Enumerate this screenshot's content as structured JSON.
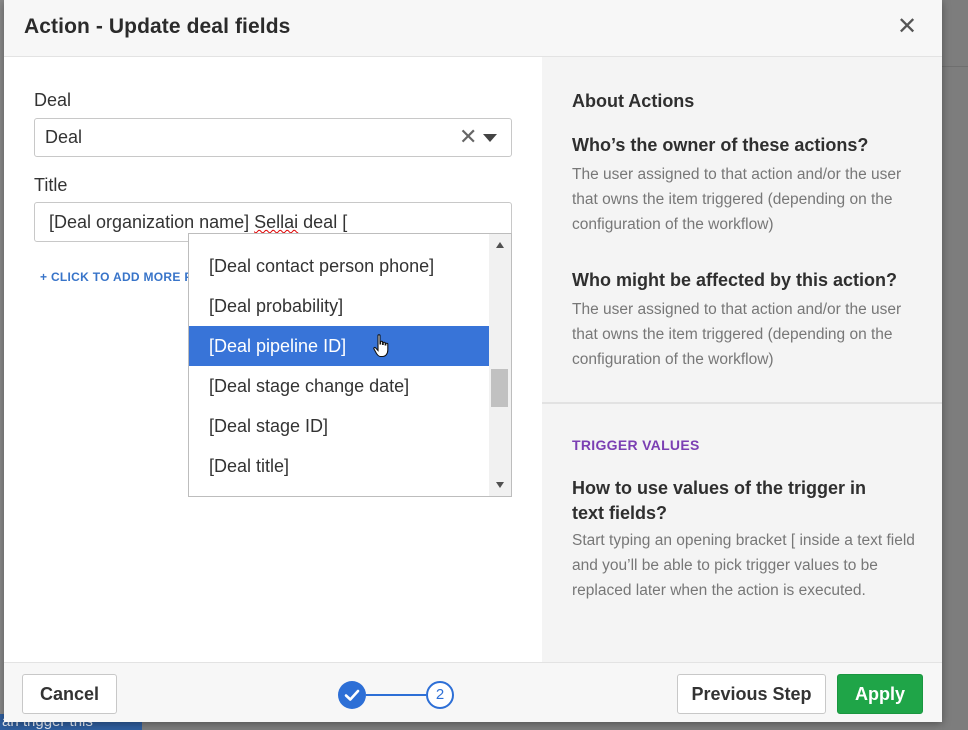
{
  "modal": {
    "title": "Action - Update deal fields",
    "close_glyph": "✕"
  },
  "form": {
    "deal_label": "Deal",
    "deal_value": "Deal",
    "clear_glyph": "✕",
    "title_label": "Title",
    "title_value_pre": "[Deal organization name] ",
    "title_value_word": "Sellai",
    "title_value_post": " deal [",
    "add_more_link": "+ CLICK TO ADD MORE FIE"
  },
  "dropdown": {
    "items": [
      {
        "label": "[Deal contact person phone]"
      },
      {
        "label": "[Deal probability]"
      },
      {
        "label": "[Deal pipeline ID]",
        "selected": true
      },
      {
        "label": "[Deal stage change date]"
      },
      {
        "label": "[Deal stage ID]"
      },
      {
        "label": "[Deal title]"
      }
    ]
  },
  "about": {
    "heading": "About Actions",
    "owner_question": "Who’s the owner of these actions?",
    "owner_answer": "The user assigned to that action and/or the user that owns the item triggered (depending on the configuration of the workflow)",
    "affected_question": "Who might be affected by this action?",
    "affected_answer": "The user assigned to that action and/or the user that owns the item triggered (depending on the configuration of the workflow)",
    "trigger_section": "TRIGGER VALUES",
    "trigger_question": "How to use values of the trigger in text fields?",
    "trigger_answer": "Start typing an opening bracket [ inside a text field and you’ll be able to pick trigger values to be replaced later when the action is executed."
  },
  "footer": {
    "cancel_label": "Cancel",
    "step_current": "2",
    "previous_label": "Previous Step",
    "apply_label": "Apply"
  },
  "backdrop": {
    "partial_text": "an trigger this"
  },
  "colors": {
    "accent_blue": "#3874d8",
    "apply_green": "#1fa548",
    "trigger_purple": "#7b3fb3"
  }
}
